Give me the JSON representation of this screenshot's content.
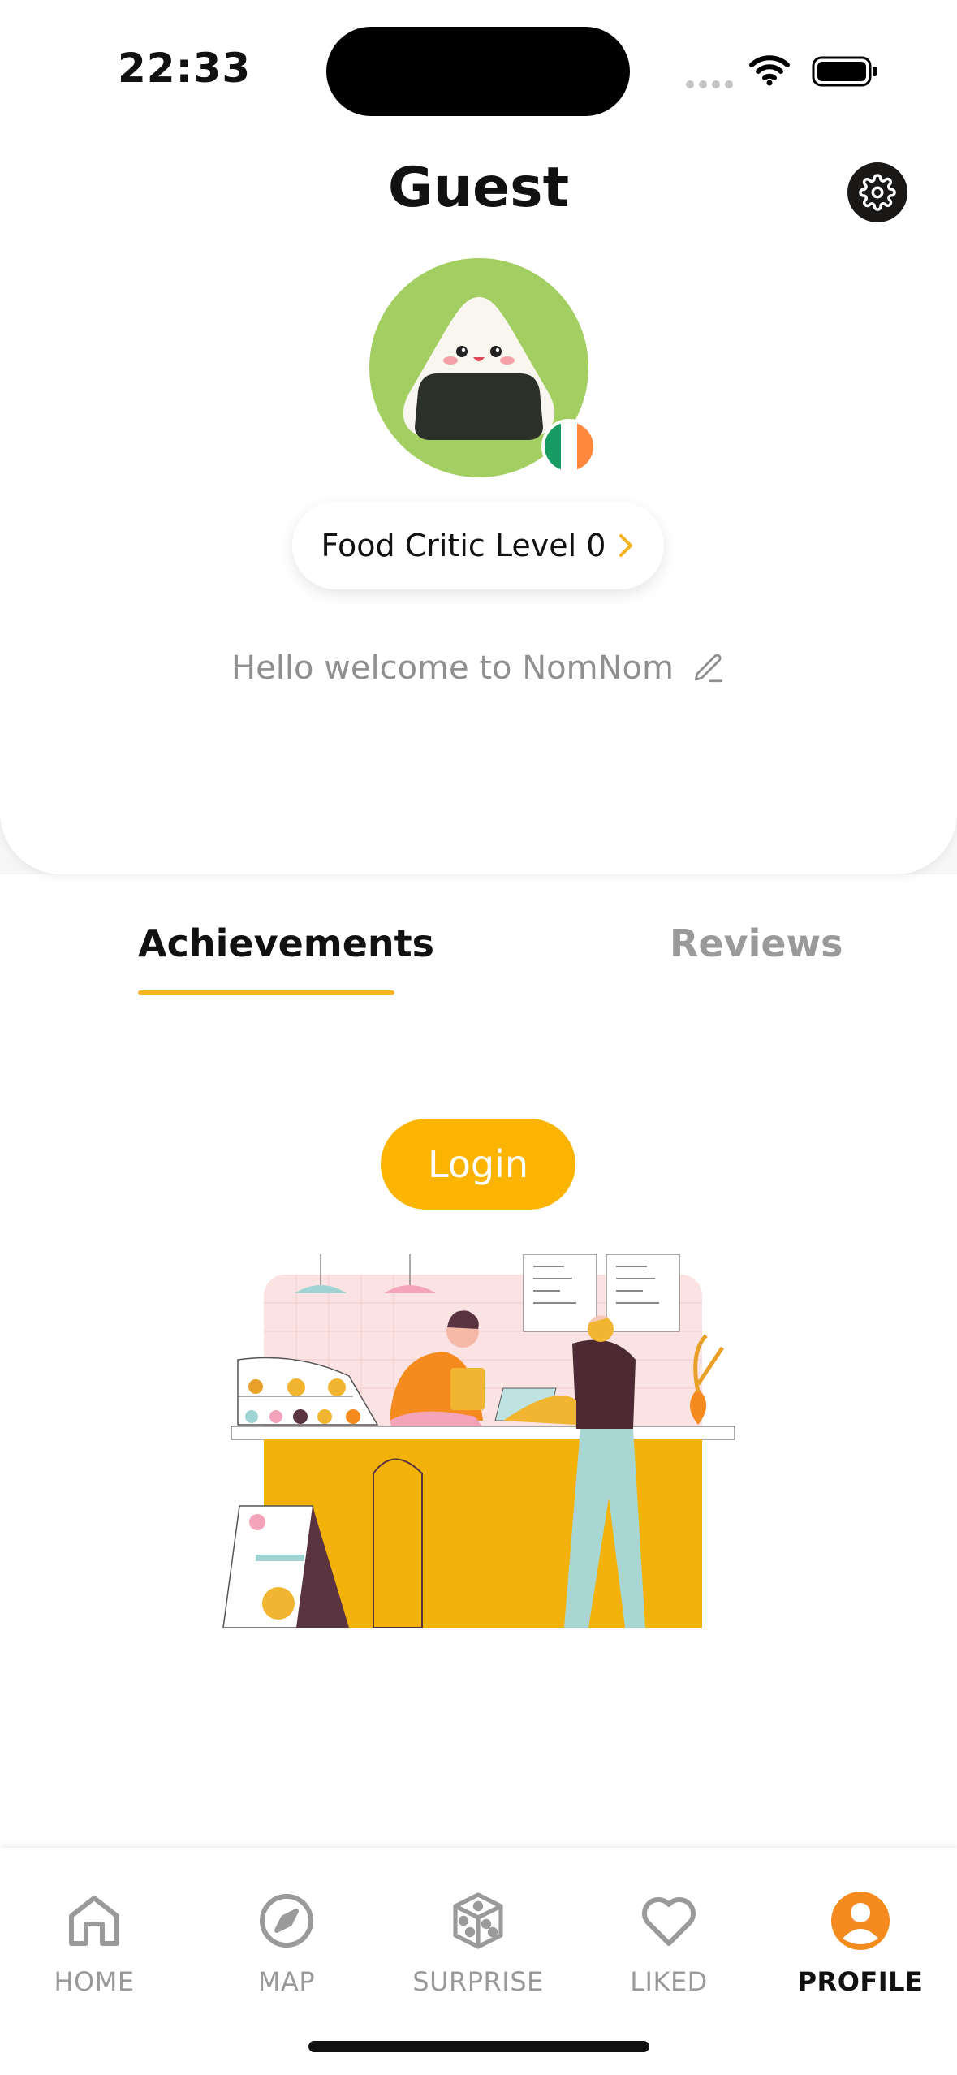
{
  "status_bar": {
    "time": "22:33"
  },
  "profile": {
    "name": "Guest",
    "level_label": "Food Critic Level 0",
    "bio": "Hello welcome to NomNom",
    "flag_colors": [
      "#169b62",
      "#ffffff",
      "#ff883e"
    ]
  },
  "tabs": [
    {
      "label": "Achievements",
      "active": true
    },
    {
      "label": "Reviews",
      "active": false
    }
  ],
  "login": {
    "label": "Login"
  },
  "nav": [
    {
      "label": "HOME",
      "icon": "home-icon",
      "active": false
    },
    {
      "label": "MAP",
      "icon": "compass-icon",
      "active": false
    },
    {
      "label": "SURPRISE",
      "icon": "dice-icon",
      "active": false
    },
    {
      "label": "LIKED",
      "icon": "heart-icon",
      "active": false
    },
    {
      "label": "PROFILE",
      "icon": "profile-icon",
      "active": true
    }
  ],
  "colors": {
    "accent": "#fbb400",
    "avatar_bg": "#a3cf62",
    "profile_active": "#f58a1f",
    "inactive": "#9a9a9a"
  }
}
